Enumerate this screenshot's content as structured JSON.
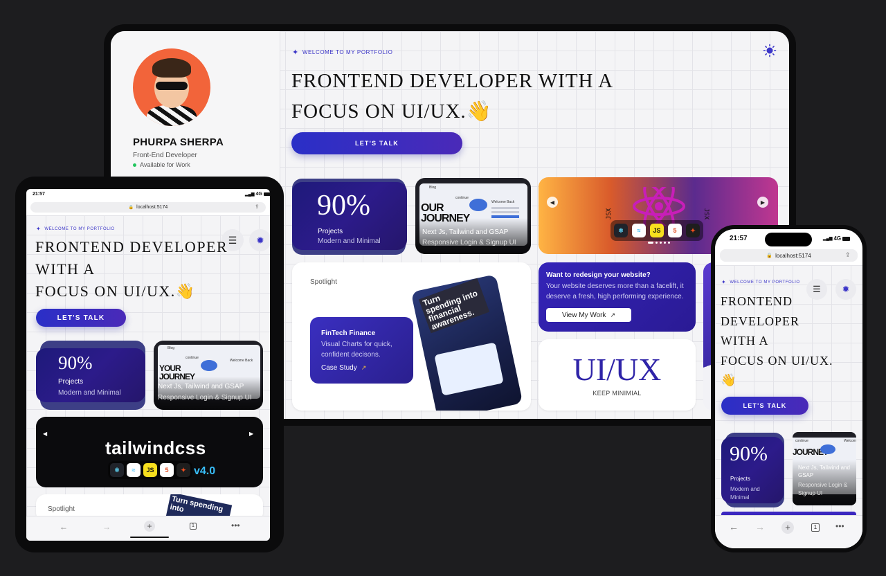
{
  "laptop": {
    "profile": {
      "name": "PHURPA SHERPA",
      "role": "Front-End Developer",
      "status": "Available for Work",
      "status_color": "#22c55e"
    },
    "welcome": "WELCOME TO MY PORTFOLIO",
    "hero_line1": "FRONTEND DEVELOPER WITH A",
    "hero_line2": "FOCUS ON UI/UX.👋",
    "cta": "LET'S TALK",
    "projects": {
      "number": "90%",
      "label": "Projects",
      "sub": "Modern and Minimal"
    },
    "blog": {
      "brand": "Blog",
      "continue": "continue",
      "welcome_back": "Welcome Back",
      "journey": "OUR JOURNEY",
      "title": "Next Js, Tailwind and GSAP",
      "sub": "Responsive Login & Signup UI"
    },
    "tech": {
      "jsx_left": "JSX",
      "jsx_right": "JSX",
      "badges": [
        "⚛",
        "≈",
        "JS",
        "5",
        "✦"
      ]
    },
    "spotlight": {
      "label": "Spotlight",
      "fin_title": "FinTech Finance",
      "fin_desc": "Visual Charts for quick, confident decisons.",
      "fin_link": "Case Study",
      "mock_text": "Turn spending into financial awareness."
    },
    "redesign": {
      "title": "Want to redesign your website?",
      "desc": "Your website deserves more than a facelift, it deserve a fresh, high performing experience.",
      "button": "View My Work"
    },
    "uiux": {
      "big": "UI/UX",
      "sub": "KEEP MINIMIAL"
    }
  },
  "tablet": {
    "time": "21:57",
    "signal": "4G",
    "url": "localhost:5174",
    "welcome": "WELCOME TO MY PORTFOLIO",
    "hero_line1": "FRONTEND DEVELOPER",
    "hero_line2": "WITH A",
    "hero_line3": "FOCUS ON UI/UX.👋",
    "cta": "LET'S TALK",
    "projects": {
      "number": "90%",
      "label": "Projects",
      "sub": "Modern and Minimal"
    },
    "blog": {
      "brand": "Blog",
      "continue": "continue",
      "welcome_back": "Welcome Back",
      "journey": "YOUR JOURNEY",
      "title": "Next Js, Tailwind and GSAP",
      "sub": "Responsive Login & Signup UI"
    },
    "tailwind": {
      "text": "tailwindcss",
      "version": "v4.0"
    },
    "spotlight": "Spotlight",
    "spotlight_mock": "Turn spending into",
    "toolbar": {
      "tab_count": "1"
    }
  },
  "phone": {
    "time": "21:57",
    "signal": "4G",
    "url": "localhost:5174",
    "welcome": "WELCOME TO MY PORTFOLIO",
    "hero_line1": "FRONTEND",
    "hero_line2": "DEVELOPER",
    "hero_line3": "WITH A",
    "hero_line4": "FOCUS ON UI/UX.",
    "hero_emoji": "👋",
    "cta": "LET'S TALK",
    "projects": {
      "number": "90%",
      "label": "Projects",
      "sub": "Modern and Minimal"
    },
    "blog": {
      "continue": "continue",
      "welcome": "Welcom",
      "journey": "JOURNEY",
      "title": "Next Js, Tailwind and GSAP",
      "sub": "Responsive Login & Signup UI"
    },
    "toolbar": {
      "tab_count": "1"
    }
  },
  "colors": {
    "accent": "#3b35c8",
    "cta_gradient_start": "#2a2fc7",
    "card_purple": "#2c1b8a"
  }
}
